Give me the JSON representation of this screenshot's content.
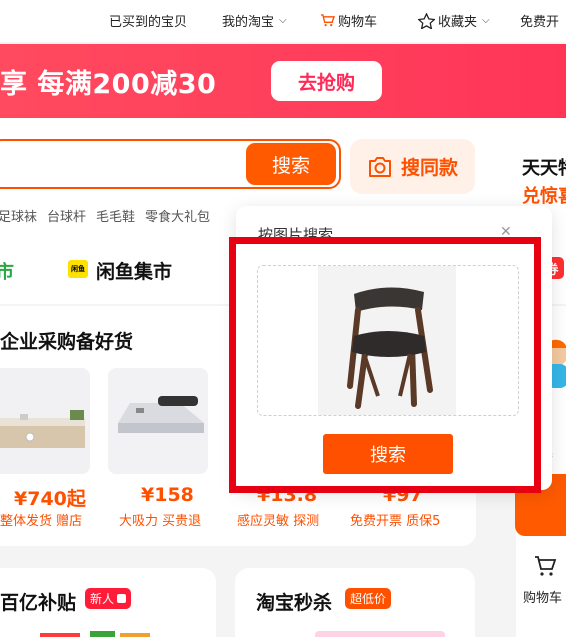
{
  "topnav": {
    "bought": "已买到的宝贝",
    "my_taobao": "我的淘宝",
    "cart": "购物车",
    "favorites": "收藏夹",
    "free_open": "免费开"
  },
  "banner": {
    "promo": "享 每满200减30",
    "grab_button": "去抢购"
  },
  "search": {
    "button": "搜索",
    "image_search": "搜同款",
    "hotwords": [
      "足球袜",
      "台球杆",
      "毛毛鞋",
      "零食大礼包"
    ],
    "side_title": "天天特",
    "side_sub": "兑惊喜"
  },
  "categories": {
    "first": "市",
    "xianyu_logo": "闲鱼",
    "xianyu": "闲鱼集市",
    "coupon": "券"
  },
  "enterprise": {
    "title": "企业采购备好货",
    "products": [
      {
        "price": "¥740起",
        "tag": "整体发货 赠店"
      },
      {
        "price": "¥158",
        "tag": "大吸力 买贵退"
      },
      {
        "price": "¥13.8",
        "tag": "感应灵敏 探测"
      },
      {
        "price": "¥97",
        "tag": "免费开票 质保5"
      }
    ]
  },
  "right": {
    "tiny_text": "嘿",
    "cart_label": "购物车"
  },
  "bottom": {
    "subsidy_title": "百亿补贴",
    "subsidy_badge": "新人",
    "flash_title": "淘宝秒杀",
    "flash_badge": "超低价"
  },
  "popup": {
    "title": "按图片搜索",
    "close": "✕",
    "search_button": "搜索"
  },
  "colors": {
    "brand_orange": "#ff5000",
    "banner_red": "#ff3d5c",
    "highlight_red": "#e60012"
  }
}
